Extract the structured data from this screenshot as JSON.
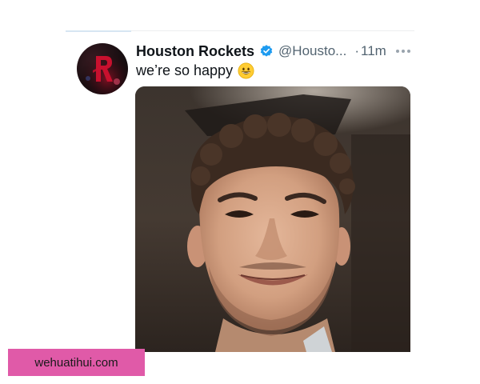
{
  "tweet": {
    "author_name": "Houston Rockets",
    "author_handle": "@Housto...",
    "time": "11m",
    "text": "we’re so happy",
    "emoji": "grinning-face-emoji",
    "verified_color": "#1d9bf0"
  },
  "watermark": {
    "text": "wehuatihui.com",
    "color": "#e05aa8"
  }
}
